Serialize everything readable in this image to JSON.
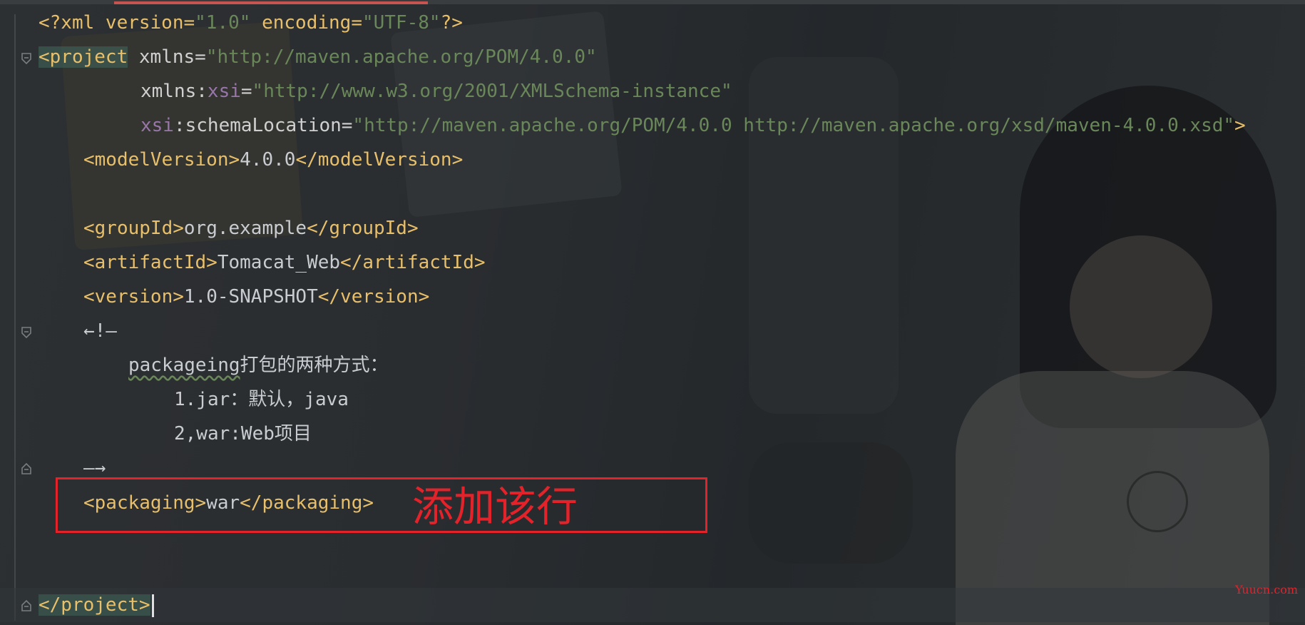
{
  "editor": {
    "lines": {
      "l1": {
        "a": "<?xml version=",
        "b": "\"1.0\"",
        "c": " encoding=",
        "d": "\"UTF-8\"",
        "e": "?>"
      },
      "l2": {
        "a": "<project",
        "b": " xmlns=",
        "c": "\"http://maven.apache.org/POM/4.0.0\""
      },
      "l3": {
        "a": "xmlns:",
        "b": "xsi",
        "c": "=",
        "d": "\"http://www.w3.org/2001/XMLSchema-instance\""
      },
      "l4": {
        "a": "xsi",
        "b": ":schemaLocation=",
        "c": "\"http://maven.apache.org/POM/4.0.0 http://maven.apache.org/xsd/maven-4.0.0.xsd\"",
        "d": ">"
      },
      "l5": {
        "open": "<modelVersion>",
        "value": "4.0.0",
        "close": "</modelVersion>"
      },
      "l7": {
        "open": "<groupId>",
        "value": "org.example",
        "close": "</groupId>"
      },
      "l8": {
        "open": "<artifactId>",
        "value": "Tomacat_Web",
        "close": "</artifactId>"
      },
      "l9": {
        "open": "<version>",
        "value": "1.0-SNAPSHOT",
        "close": "</version>"
      },
      "l10": {
        "text": "←!—"
      },
      "l11": {
        "a": "packageing",
        "b": "打包的两种方式："
      },
      "l12": {
        "a": "1.jar",
        "b": "：默认，",
        "c": "java"
      },
      "l13": {
        "a": "2,war:Web",
        "b": "项目"
      },
      "l14": {
        "text": "—→"
      },
      "l15": {
        "open": "<packaging>",
        "value": "war",
        "close": "</packaging>"
      },
      "l18": {
        "open": "</project>"
      }
    }
  },
  "annotation": {
    "label": "添加该行",
    "color": "#e3222a"
  },
  "watermark": {
    "text": "Yuucn.com"
  },
  "colors": {
    "tag": "#e8bf6a",
    "string": "#6a8759",
    "namespace": "#9876aa",
    "text": "#cfd2d6",
    "accent": "#c75450"
  }
}
